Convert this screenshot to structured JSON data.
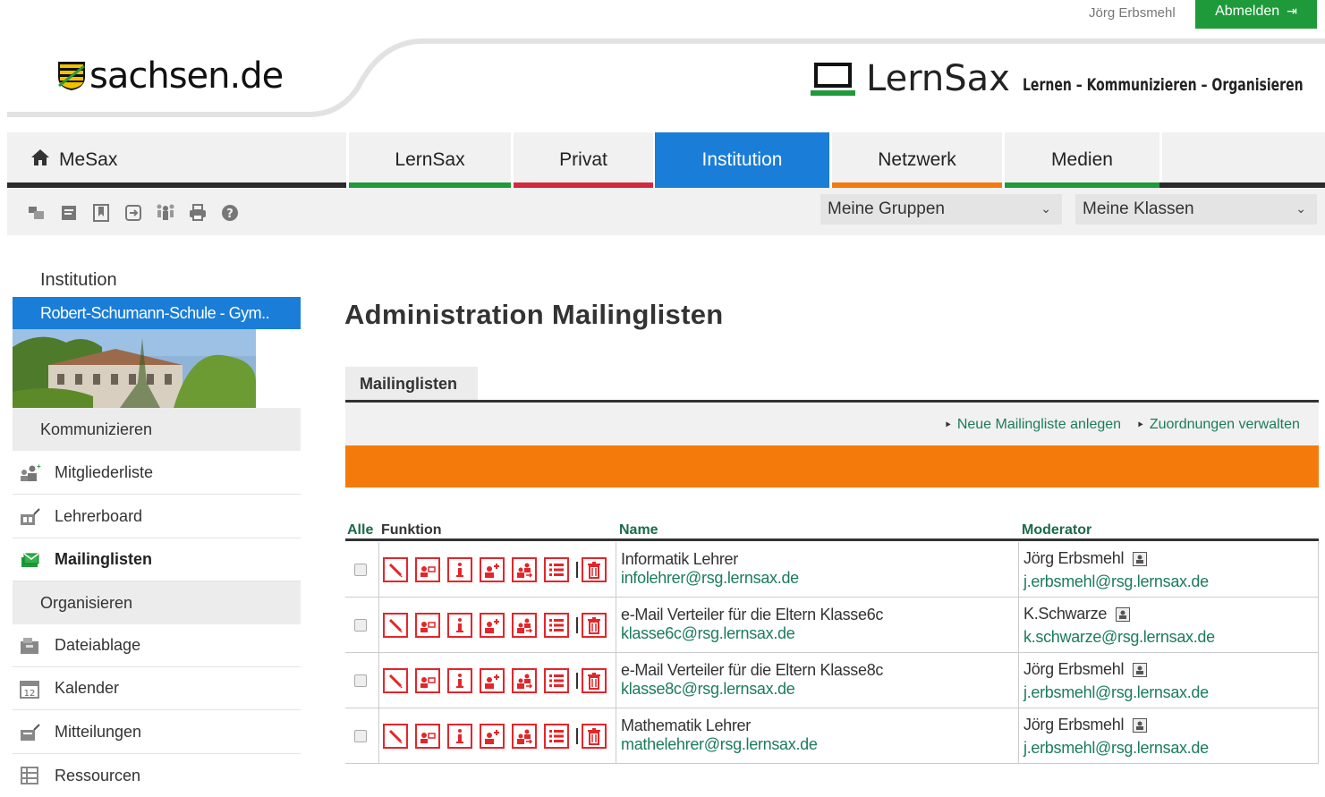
{
  "top": {
    "user": "Jörg Erbsmehl",
    "login_label": "Abmelden"
  },
  "header": {
    "sachsen_logo": "sachsen.de",
    "brand": "LernSax",
    "tagline": "Lernen – Kommunizieren – Organisieren"
  },
  "nav": {
    "tabs": [
      {
        "label": "MeSax",
        "color": "#2b2b2b"
      },
      {
        "label": "LernSax",
        "color": "#1f9a3a"
      },
      {
        "label": "Privat",
        "color": "#d4283b"
      },
      {
        "label": "Institution",
        "color": "#1a7dd7",
        "active": true
      },
      {
        "label": "Netzwerk",
        "color": "#f47b0b"
      },
      {
        "label": "Medien",
        "color": "#1f9a3a"
      }
    ]
  },
  "toolbar": {
    "icons": [
      "windows-icon",
      "notes-icon",
      "bookmark-icon",
      "login-icon",
      "sitemap-icon",
      "print-icon",
      "help-icon"
    ],
    "group_select": "Meine Gruppen",
    "class_select": "Meine Klassen"
  },
  "sidebar": {
    "heading": "Institution",
    "school": "Robert-Schumann-Schule - Gym..",
    "sections": [
      "Kommunizieren",
      "Organisieren"
    ],
    "items": [
      {
        "label": "Mitgliederliste",
        "icon": "members-icon"
      },
      {
        "label": "Lehrerboard",
        "icon": "board-icon"
      },
      {
        "label": "Mailinglisten",
        "icon": "mailinglist-icon",
        "active": true
      },
      {
        "label": "Dateiablage",
        "icon": "files-icon"
      },
      {
        "label": "Kalender",
        "icon": "calendar-icon",
        "calendar_day": "12"
      },
      {
        "label": "Mitteilungen",
        "icon": "messages-icon"
      },
      {
        "label": "Ressourcen",
        "icon": "resources-icon"
      }
    ]
  },
  "main": {
    "title": "Administration Mailinglisten",
    "tab": "Mailinglisten",
    "actions": [
      "Neue Mailingliste anlegen",
      "Zuordnungen verwalten"
    ],
    "columns": {
      "all": "Alle",
      "function": "Funktion",
      "name": "Name",
      "moderator": "Moderator"
    },
    "function_icons": [
      "edit-icon",
      "member-card-icon",
      "info-icon",
      "add-member-icon",
      "members-swap-icon",
      "list-icon",
      "delete-icon"
    ],
    "rows": [
      {
        "name": "Informatik Lehrer",
        "email": "infolehrer@rsg.lernsax.de",
        "moderator": "Jörg Erbsmehl",
        "moderator_email": "j.erbsmehl@rsg.lernsax.de"
      },
      {
        "name": "e-Mail Verteiler für die Eltern Klasse6c",
        "email": "klasse6c@rsg.lernsax.de",
        "moderator": "K.Schwarze",
        "moderator_email": "k.schwarze@rsg.lernsax.de"
      },
      {
        "name": "e-Mail Verteiler für die Eltern Klasse8c",
        "email": "klasse8c@rsg.lernsax.de",
        "moderator": "Jörg Erbsmehl",
        "moderator_email": "j.erbsmehl@rsg.lernsax.de"
      },
      {
        "name": "Mathematik Lehrer",
        "email": "mathelehrer@rsg.lernsax.de",
        "moderator": "Jörg Erbsmehl",
        "moderator_email": "j.erbsmehl@rsg.lernsax.de"
      }
    ]
  }
}
